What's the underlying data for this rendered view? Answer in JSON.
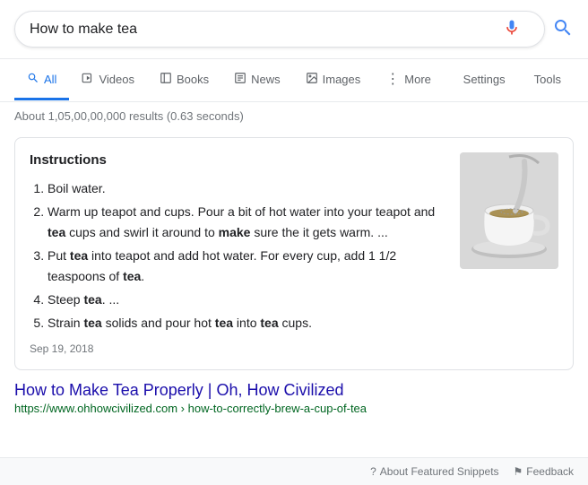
{
  "search": {
    "query": "How to make tea",
    "mic_icon": "mic",
    "search_icon": "search"
  },
  "nav": {
    "tabs": [
      {
        "id": "all",
        "label": "All",
        "icon": "🔍",
        "active": true
      },
      {
        "id": "videos",
        "label": "Videos",
        "icon": "▶"
      },
      {
        "id": "books",
        "label": "Books",
        "icon": "📖"
      },
      {
        "id": "news",
        "label": "News",
        "icon": "📰"
      },
      {
        "id": "images",
        "label": "Images",
        "icon": "🖼"
      },
      {
        "id": "more",
        "label": "More",
        "icon": "⋮"
      }
    ],
    "right_tabs": [
      {
        "id": "settings",
        "label": "Settings"
      },
      {
        "id": "tools",
        "label": "Tools"
      }
    ]
  },
  "results": {
    "count_text": "About 1,05,00,00,000 results (0.63 seconds)"
  },
  "snippet": {
    "title": "Instructions",
    "steps": [
      "Boil water.",
      "Warm up teapot and cups. Pour a bit of hot water into your teapot and <b>tea</b> cups and swirl it around to <b>make</b> sure the it gets warm. ...",
      "Put <b>tea</b> into teapot and add hot water. For every cup, add 1 1/2 teaspoons of <b>tea</b>.",
      "Steep <b>tea</b>. ...",
      "Strain <b>tea</b> solids and pour hot <b>tea</b> into <b>tea</b> cups."
    ],
    "date": "Sep 19, 2018"
  },
  "top_result": {
    "title": "How to Make Tea Properly | Oh, How Civilized",
    "url": "https://www.ohhowcivilized.com › how-to-correctly-brew-a-cup-of-tea"
  },
  "footer": {
    "snippet_label": "About Featured Snippets",
    "feedback_label": "Feedback"
  }
}
